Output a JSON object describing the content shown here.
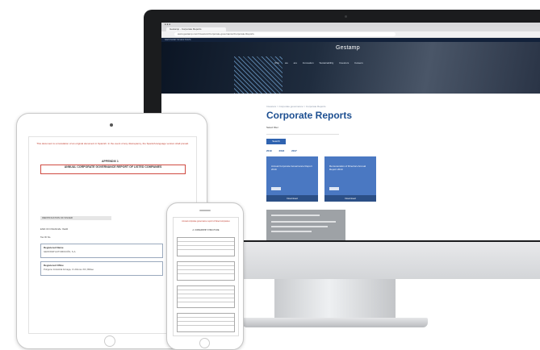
{
  "desktop": {
    "browser_tab": "Gestamp - Corporate Reports",
    "address": "www.gestamp.com/Investors/Corporate-governance/Corporate-Reports",
    "site_topbar": "GESTAMP INVESTORS",
    "logo": "Gestamp",
    "nav": "Who we are   Innovation   Sustainability   Investors   Careers",
    "breadcrumb": "Investors > Corporate governance > Corporate Reports",
    "page_title": "Corporate Reports",
    "filter_label": "Select filter",
    "search_button": "Search",
    "years": [
      "2019",
      "2018",
      "2017"
    ],
    "cards": [
      {
        "label": "Annual Corporate Governance Report 2019",
        "download": "Download"
      },
      {
        "label": "Remuneration of Directors Annual Report 2019",
        "download": "Download"
      }
    ],
    "contact_title": "INVESTOR RELATIONS CONTACT"
  },
  "tablet": {
    "red_note": "This document is a translation of an original document in Spanish. In the event of any discrepancy, the Spanish-language version shall prevail.",
    "heading": "APPENDIX 1",
    "doc_title": "ANNUAL CORPORATE GOVERNANCE REPORT OF LISTED COMPANIES",
    "chip": "IDENTIFICATION OF ISSUER",
    "end_date": "END OF FINANCIAL YEAR",
    "tax_id": "Tax ID No.",
    "registered_name_label": "Registered Name",
    "registered_name": "GESTAMP AUTOMOCIÓN, S.A.",
    "registered_office_label": "Registered Office",
    "registered_office": "Polígono Industrial Arinaga, C/ Alfonso XIII, Bilbao"
  },
  "phone": {
    "red_note": "Annual corporate governance report of listed companies",
    "section": "A. OWNERSHIP STRUCTURE"
  }
}
